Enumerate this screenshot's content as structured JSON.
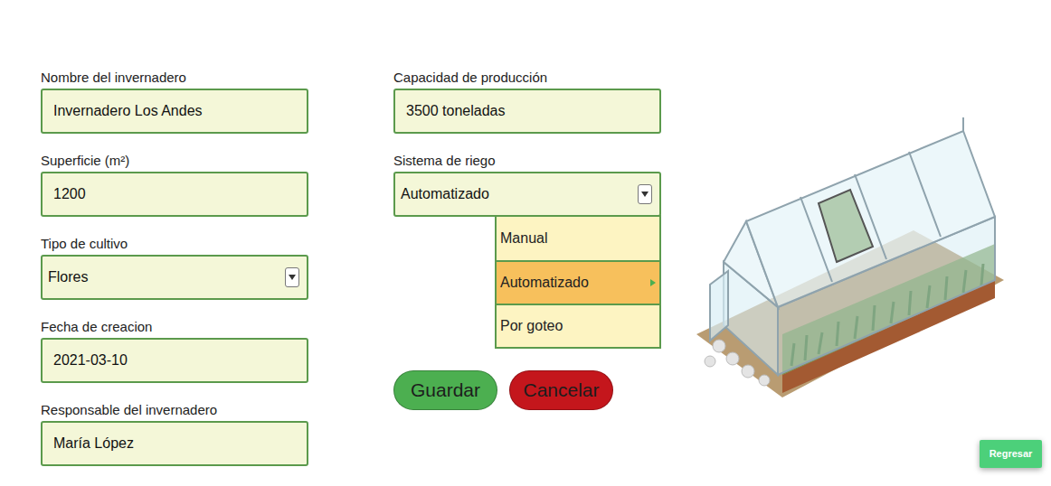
{
  "form": {
    "left_fields": [
      {
        "label": "Nombre del invernadero",
        "value": "Invernadero Los Andes",
        "kind": "text"
      },
      {
        "label": "Superficie (m²)",
        "value": "1200",
        "kind": "text"
      },
      {
        "label": "Tipo de cultivo",
        "value": "Flores",
        "kind": "select",
        "expanded": false
      },
      {
        "label": "Fecha de creacion",
        "value": "2021-03-10",
        "kind": "text"
      },
      {
        "label": "Responsable del invernadero",
        "value": "María López",
        "kind": "text"
      }
    ],
    "right_fields": [
      {
        "label": "Capacidad de producción",
        "value": "3500 toneladas",
        "kind": "text"
      },
      {
        "label": "Sistema de riego",
        "value": "Automatizado",
        "kind": "select",
        "expanded": true,
        "options": [
          {
            "label": "Manual",
            "selected": false
          },
          {
            "label": "Automatizado",
            "selected": true
          },
          {
            "label": "Por goteo",
            "selected": false
          }
        ]
      }
    ]
  },
  "buttons": [
    {
      "label": "Guardar",
      "color": "#4caf50"
    },
    {
      "label": "Cancelar",
      "color": "#c4161c"
    }
  ],
  "back_button": {
    "label": "Regresar"
  }
}
